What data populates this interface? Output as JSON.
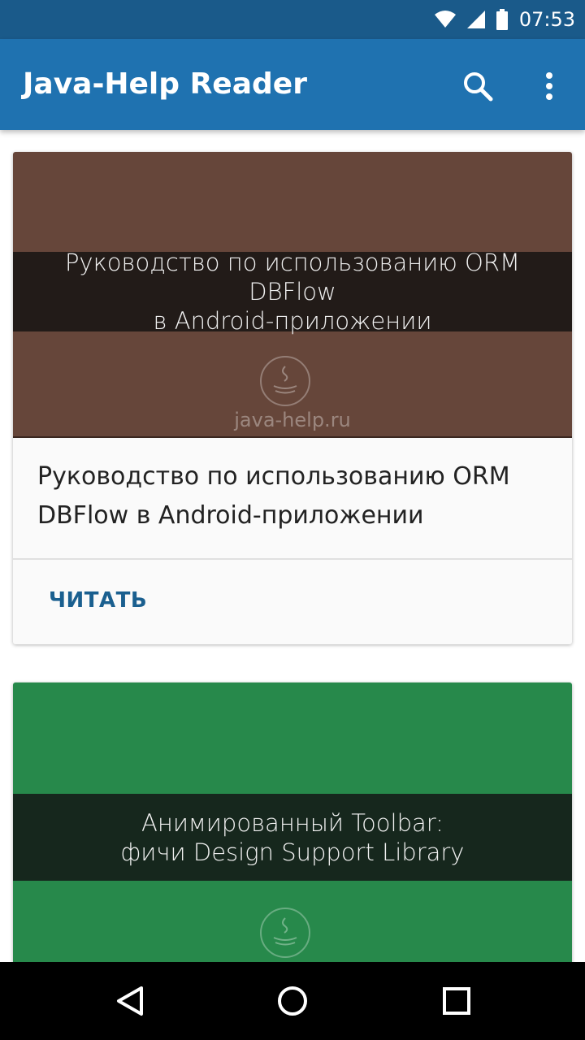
{
  "status_bar": {
    "time": "07:53",
    "icons": [
      "wifi-icon",
      "cell-signal-icon",
      "battery-icon"
    ]
  },
  "app_bar": {
    "title": "Java-Help Reader",
    "actions": [
      "search-icon",
      "more-vert-icon"
    ]
  },
  "colors": {
    "status_bar": "#1a5a8a",
    "app_bar": "#1f72b0",
    "card1_image": "#66463a",
    "card2_image": "#27894b",
    "action_text": "#1a5f8f"
  },
  "cards": [
    {
      "image_text_line1": "Руководство по использованию ORM DBFlow",
      "image_text_line2": "в Android-приложении",
      "watermark": "java-help.ru",
      "title": "Руководство по использованию ORM DBFlow в Android-приложении",
      "action_label": "ЧИТАТЬ"
    },
    {
      "image_text_line1": "Анимированный Toolbar:",
      "image_text_line2": "фичи Design Support Library"
    }
  ],
  "nav_bar": {
    "buttons": [
      "back-icon",
      "home-icon",
      "recents-icon"
    ]
  }
}
